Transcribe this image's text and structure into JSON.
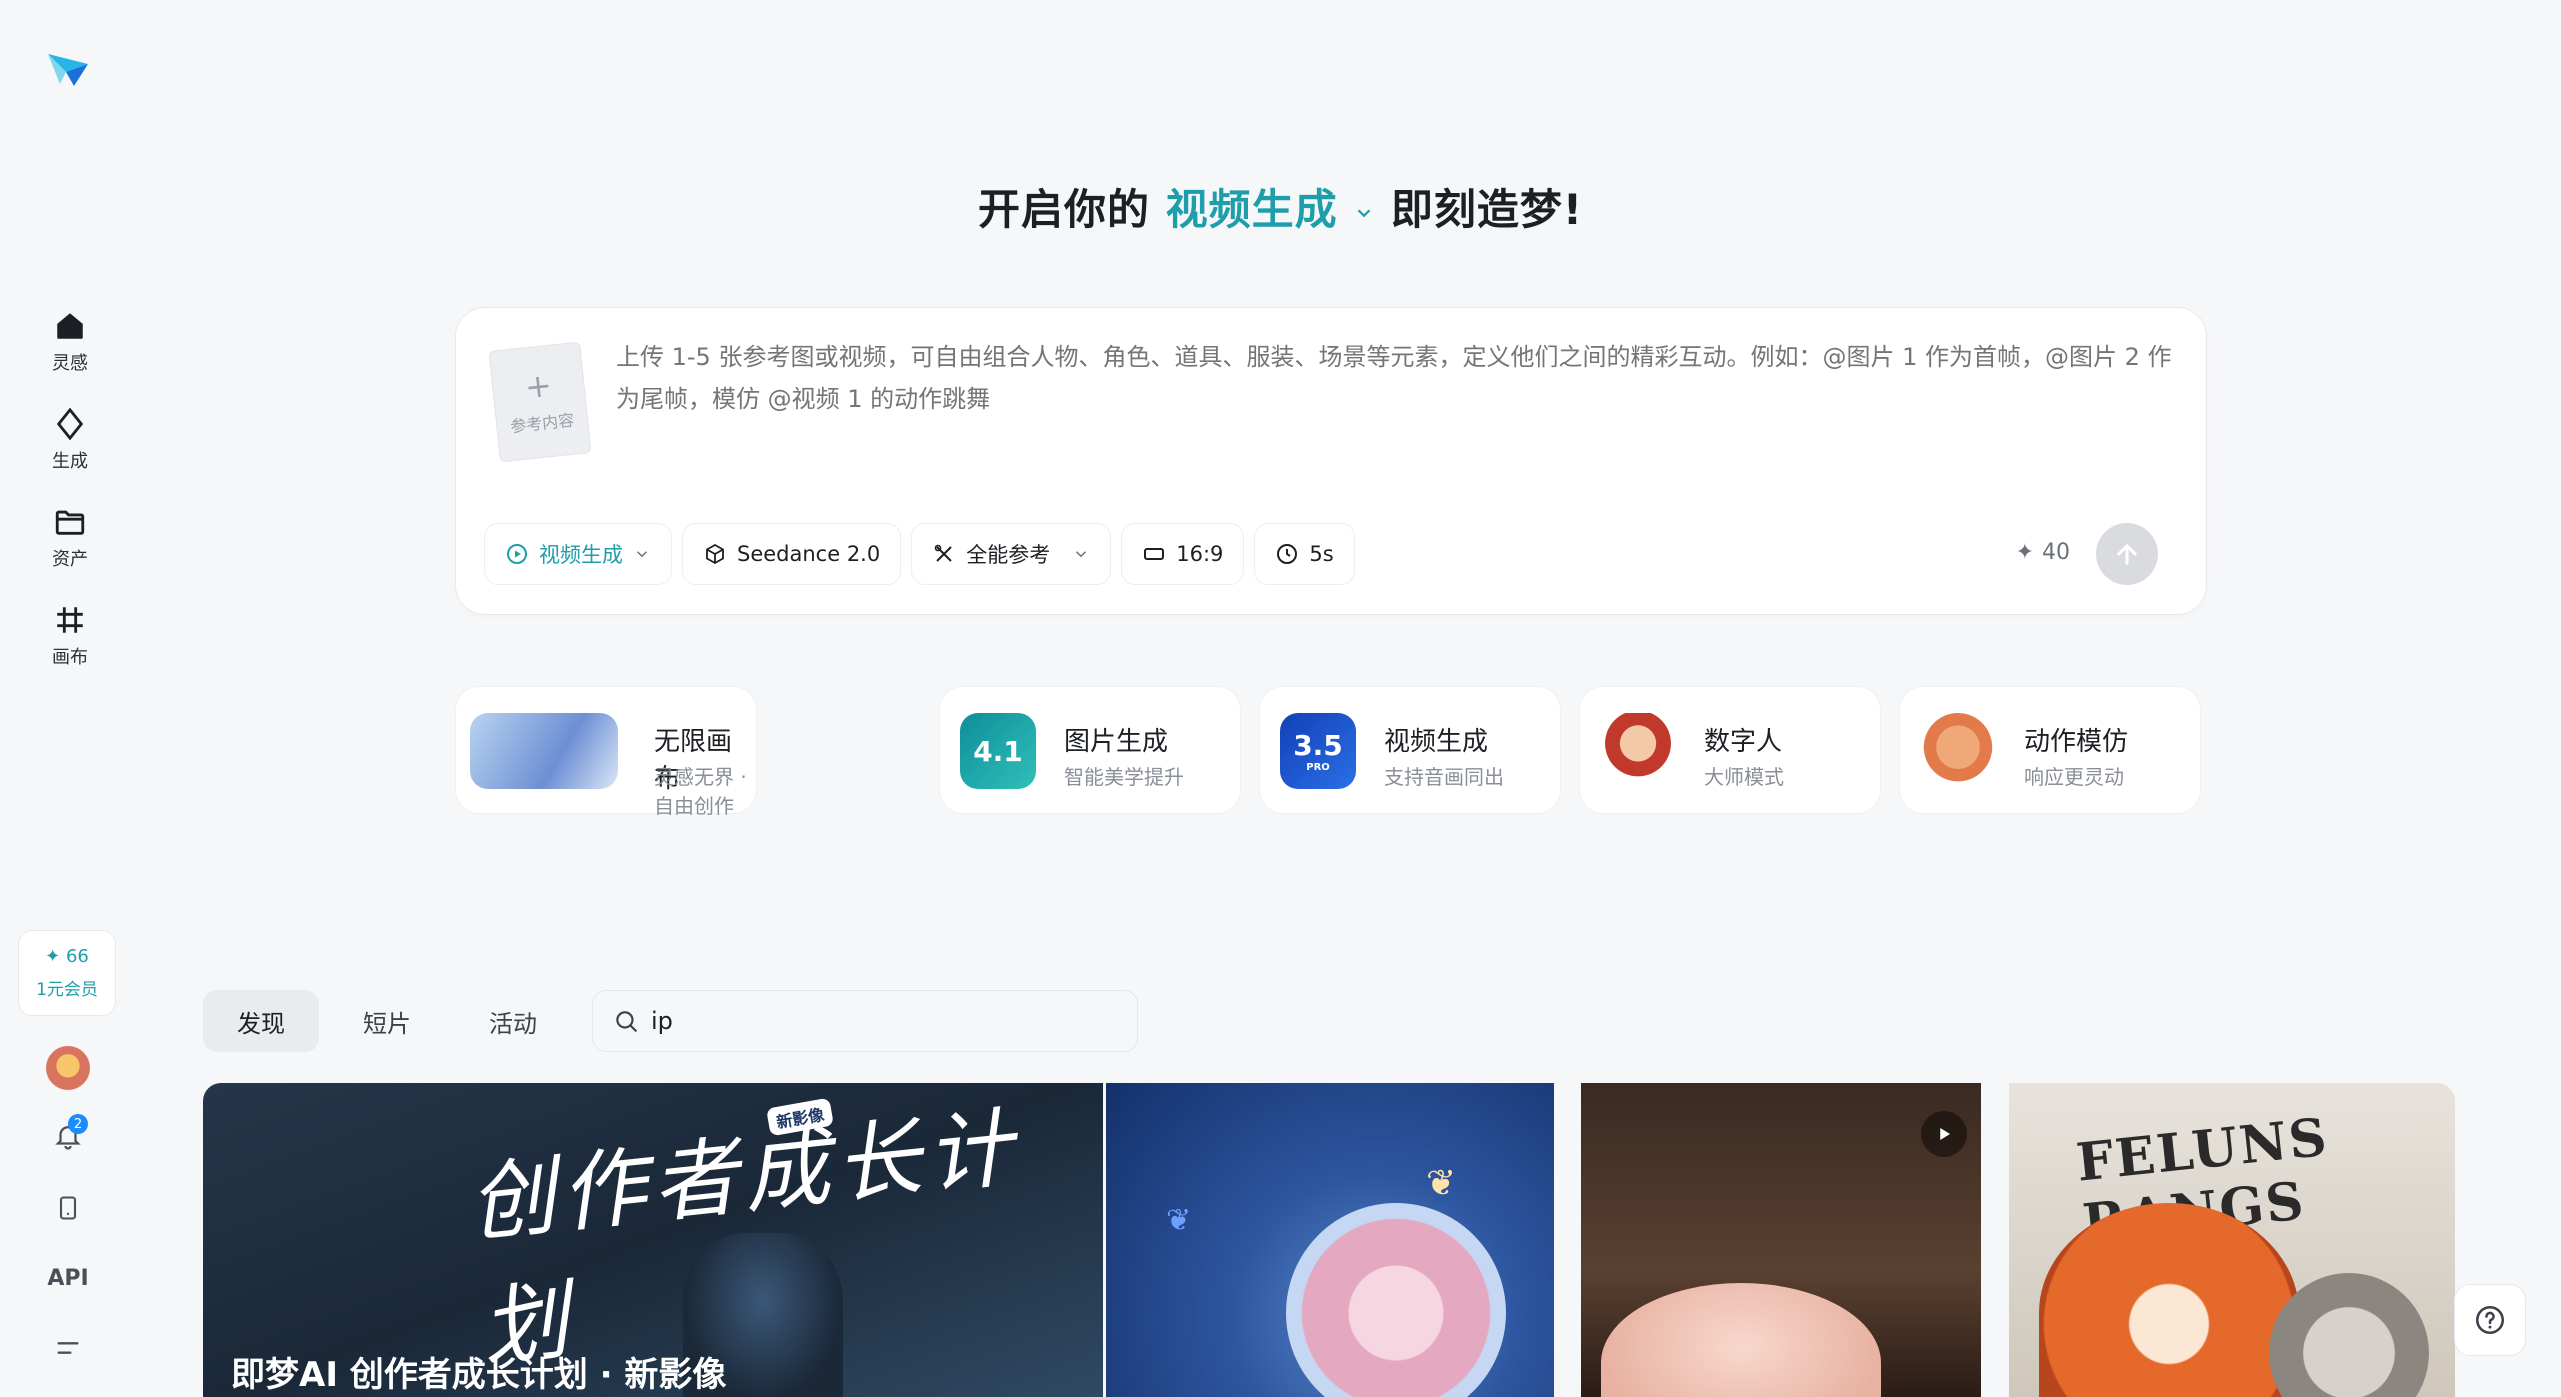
{
  "sidebar": {
    "logo": "jimeng-logo",
    "items": [
      {
        "label": "灵感",
        "icon": "home-icon"
      },
      {
        "label": "生成",
        "icon": "sparkle-icon"
      },
      {
        "label": "资产",
        "icon": "folder-icon"
      },
      {
        "label": "画布",
        "icon": "canvas-icon"
      }
    ],
    "credits": "✦ 66",
    "membership": "1元会员",
    "notification_count": "2",
    "api_label": "API"
  },
  "headline": {
    "prefix": "开启你的",
    "mode": "视频生成",
    "suffix": "即刻造梦!"
  },
  "prompt": {
    "upload_label": "参考内容",
    "placeholder": "上传 1-5 张参考图或视频，可自由组合人物、角色、道具、服装、场景等元素，定义他们之间的精彩互动。例如：@图片 1 作为首帧，@图片 2 作为尾帧，模仿 @视频 1 的动作跳舞",
    "toolbar": {
      "mode": "视频生成",
      "model": "Seedance 2.0",
      "reference": "全能参考",
      "ratio": "16:9",
      "duration": "5s"
    },
    "cost": "40"
  },
  "features": [
    {
      "title": "无限画布",
      "subtitle": "灵感无界 · 自由创作"
    },
    {
      "title": "图片生成",
      "subtitle": "智能美学提升",
      "badge": "4.1"
    },
    {
      "title": "视频生成",
      "subtitle": "支持音画同出",
      "badge": "3.5",
      "badge_sub": "PRO"
    },
    {
      "title": "数字人",
      "subtitle": "大师模式"
    },
    {
      "title": "动作模仿",
      "subtitle": "响应更灵动"
    }
  ],
  "tabs": [
    "发现",
    "短片",
    "活动"
  ],
  "search": {
    "value": "ip"
  },
  "gallery": {
    "banner_art_text": "创作者成长计划",
    "banner_tag": "新影像",
    "banner_caption": "即梦AI 创作者成长计划 · 新影像",
    "fox_paper_text": "FELUNS RANGS"
  },
  "colors": {
    "accent": "#1e9eaa",
    "background": "#f6f7f9"
  }
}
